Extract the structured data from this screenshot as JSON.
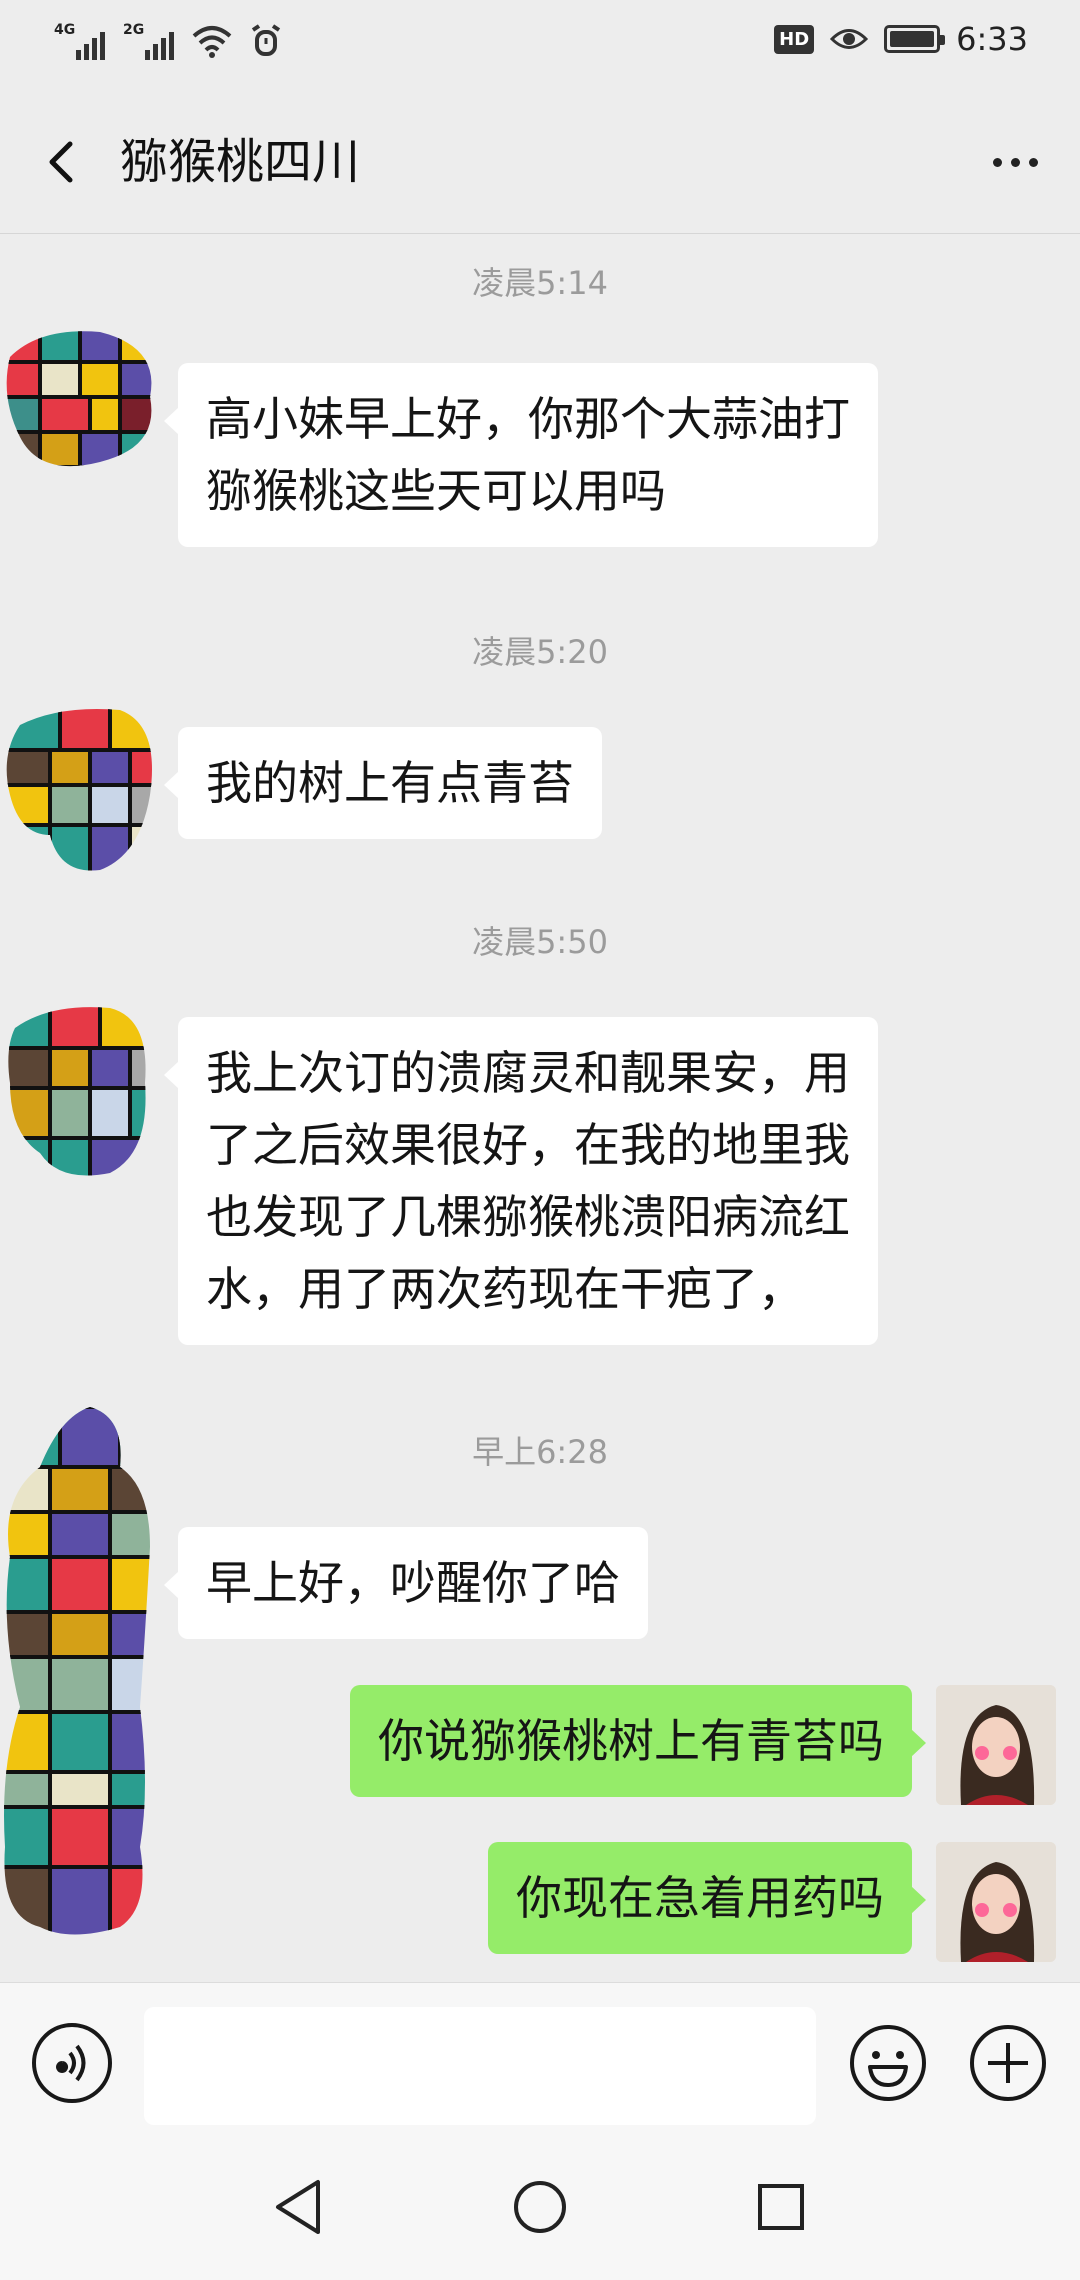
{
  "status_bar": {
    "network_1": "4G",
    "network_2": "2G",
    "hd_label": "HD",
    "time": "6:33",
    "icons": [
      "signal-4g-icon",
      "signal-2g-icon",
      "wifi-icon",
      "alarm-icon",
      "hd-icon",
      "eye-icon",
      "battery-icon"
    ]
  },
  "header": {
    "title": "猕猴桃四川",
    "back_icon": "chevron-left-icon",
    "more_icon": "more-dots-icon"
  },
  "messages": [
    {
      "type": "time",
      "text": "凌晨5:14"
    },
    {
      "type": "incoming",
      "lines": [
        "高小妹早上好，你那个大蒜油打",
        "猕猴桃这些天可以用吗"
      ]
    },
    {
      "type": "time",
      "text": "凌晨5:20"
    },
    {
      "type": "incoming",
      "lines": [
        "我的树上有点青苔"
      ]
    },
    {
      "type": "time",
      "text": "凌晨5:50"
    },
    {
      "type": "incoming",
      "lines": [
        "我上次订的溃腐灵和靓果安，用",
        "了之后效果很好，在我的地里我",
        "也发现了几棵猕猴桃溃阳病流红",
        "水，用了两次药现在干疤了，"
      ]
    },
    {
      "type": "time",
      "text": "早上6:28"
    },
    {
      "type": "incoming",
      "lines": [
        "早上好，吵醒你了哈"
      ]
    },
    {
      "type": "outgoing",
      "lines": [
        "你说猕猴桃树上有青苔吗"
      ]
    },
    {
      "type": "outgoing",
      "lines": [
        "你现在急着用药吗"
      ]
    }
  ],
  "input_bar": {
    "text_value": "",
    "icons": [
      "voice-icon",
      "emoji-icon",
      "plus-icon"
    ]
  },
  "nav_bar": {
    "icons": [
      "back-triangle-icon",
      "home-circle-icon",
      "recents-square-icon"
    ]
  },
  "colors": {
    "background": "#ededed",
    "incoming_bubble": "#ffffff",
    "outgoing_bubble": "#95ec69",
    "timestamp": "#9b9b9b"
  }
}
